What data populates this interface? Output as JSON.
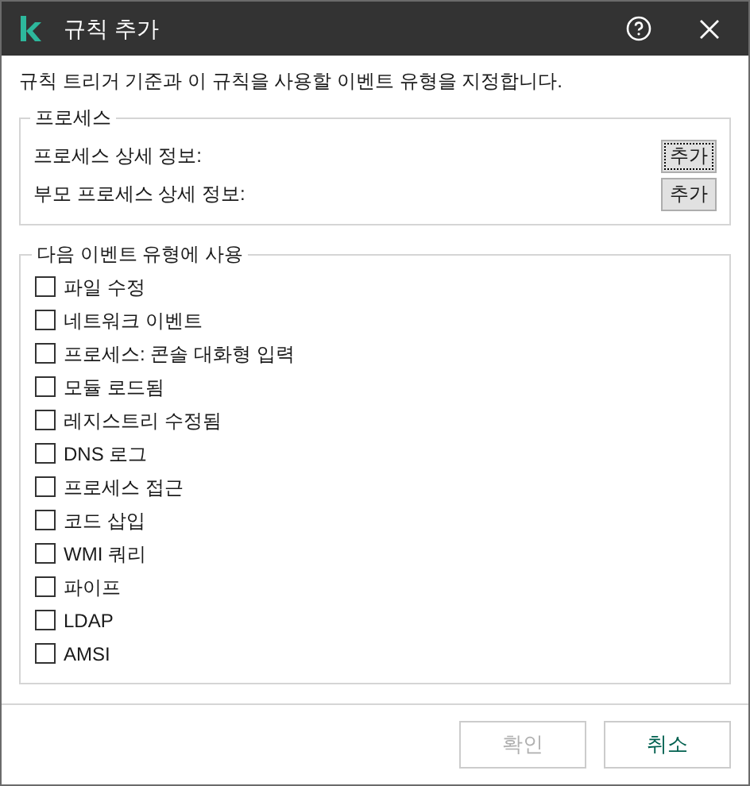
{
  "window": {
    "title": "규칙 추가"
  },
  "description": "규칙 트리거 기준과 이 규칙을 사용할 이벤트 유형을 지정합니다.",
  "process_group": {
    "title": "프로세스",
    "rows": [
      {
        "label": "프로세스 상세 정보:",
        "button": "추가",
        "focused": true
      },
      {
        "label": "부모 프로세스 상세 정보:",
        "button": "추가",
        "focused": false
      }
    ]
  },
  "event_group": {
    "title": "다음 이벤트 유형에 사용",
    "items": [
      {
        "label": "파일 수정",
        "checked": false
      },
      {
        "label": "네트워크 이벤트",
        "checked": false
      },
      {
        "label": "프로세스: 콘솔 대화형 입력",
        "checked": false
      },
      {
        "label": "모듈 로드됨",
        "checked": false
      },
      {
        "label": "레지스트리 수정됨",
        "checked": false
      },
      {
        "label": "DNS 로그",
        "checked": false
      },
      {
        "label": "프로세스 접근",
        "checked": false
      },
      {
        "label": "코드 삽입",
        "checked": false
      },
      {
        "label": "WMI 쿼리",
        "checked": false
      },
      {
        "label": "파이프",
        "checked": false
      },
      {
        "label": "LDAP",
        "checked": false
      },
      {
        "label": "AMSI",
        "checked": false
      }
    ]
  },
  "footer": {
    "buttons": [
      {
        "label": "확인",
        "disabled": true
      },
      {
        "label": "취소",
        "disabled": false
      }
    ]
  }
}
